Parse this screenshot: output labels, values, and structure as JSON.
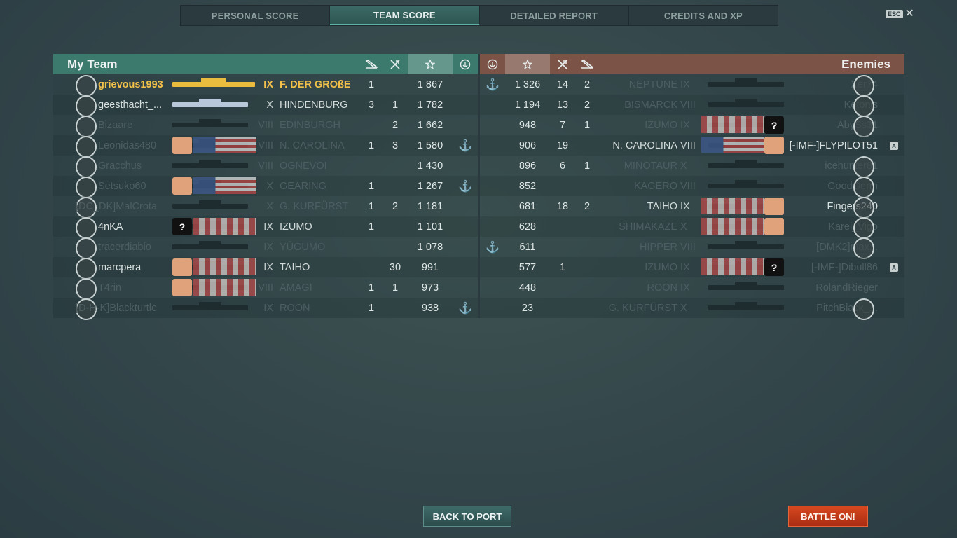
{
  "tabs": [
    {
      "label": "PERSONAL SCORE",
      "active": false
    },
    {
      "label": "TEAM SCORE",
      "active": true
    },
    {
      "label": "DETAILED REPORT",
      "active": false
    },
    {
      "label": "CREDITS AND XP",
      "active": false
    }
  ],
  "esc": {
    "key": "ESC",
    "icon": "close-icon"
  },
  "my_team": {
    "title": "My Team",
    "columns": [
      "torpedo-hits-icon",
      "planes-shot-icon",
      "score-star-icon",
      "capture-icon"
    ],
    "rows": [
      {
        "player": "grievous1993",
        "tier": "IX",
        "ship": "F. DER GROßE",
        "c1": "1",
        "c2": "",
        "score": "1 867",
        "anchor": false,
        "self": true,
        "dim": false
      },
      {
        "player": "geesthacht_...",
        "tier": "X",
        "ship": "HINDENBURG",
        "c1": "3",
        "c2": "1",
        "score": "1 782",
        "anchor": false,
        "self": false,
        "dim": false
      },
      {
        "player": "Bizaare",
        "tier": "VIII",
        "ship": "EDINBURGH",
        "c1": "",
        "c2": "2",
        "score": "1 662",
        "anchor": false,
        "self": false,
        "dim": true
      },
      {
        "player": "Leonidas480",
        "tier": "VIII",
        "ship": "N. CAROLINA",
        "c1": "1",
        "c2": "3",
        "score": "1 580",
        "anchor": true,
        "self": false,
        "dim": true
      },
      {
        "player": "Gracchus",
        "tier": "VIII",
        "ship": "OGNEVOI",
        "c1": "",
        "c2": "",
        "score": "1 430",
        "anchor": false,
        "self": false,
        "dim": true
      },
      {
        "player": "Setsuko60",
        "tier": "X",
        "ship": "GEARING",
        "c1": "1",
        "c2": "",
        "score": "1 267",
        "anchor": true,
        "self": false,
        "dim": true
      },
      {
        "player": "[DC_DK]MalCrota",
        "tier": "X",
        "ship": "G. KURFÜRST",
        "c1": "1",
        "c2": "2",
        "score": "1 181",
        "anchor": false,
        "self": false,
        "dim": true
      },
      {
        "player": "4nKA",
        "tier": "IX",
        "ship": "IZUMO",
        "c1": "1",
        "c2": "",
        "score": "1 101",
        "anchor": false,
        "self": false,
        "dim": false
      },
      {
        "player": "tracerdiablo",
        "tier": "IX",
        "ship": "YŪGUMO",
        "c1": "",
        "c2": "",
        "score": "1 078",
        "anchor": false,
        "self": false,
        "dim": true
      },
      {
        "player": "marcpera",
        "tier": "IX",
        "ship": "TAIHO",
        "c1": "",
        "c2": "30",
        "score": "991",
        "anchor": false,
        "self": false,
        "dim": false
      },
      {
        "player": "T4rin",
        "tier": "VIII",
        "ship": "AMAGI",
        "c1": "1",
        "c2": "1",
        "score": "973",
        "anchor": false,
        "self": false,
        "dim": true
      },
      {
        "player": "[D-H-K]Blackturtle",
        "tier": "IX",
        "ship": "ROON",
        "c1": "1",
        "c2": "",
        "score": "938",
        "anchor": true,
        "self": false,
        "dim": true
      }
    ]
  },
  "enemies": {
    "title": "Enemies",
    "columns": [
      "capture-icon",
      "score-star-icon",
      "planes-shot-icon",
      "torpedo-hits-icon"
    ],
    "rows": [
      {
        "player": "Xer74",
        "tier": "IX",
        "ship": "NEPTUNE",
        "c1": "14",
        "c2": "2",
        "score": "1 326",
        "anchor": true,
        "dim": true,
        "division": ""
      },
      {
        "player": "Ketonis",
        "tier": "VIII",
        "ship": "BISMARCK",
        "c1": "13",
        "c2": "2",
        "score": "1 194",
        "anchor": false,
        "dim": true,
        "division": ""
      },
      {
        "player": "AbySs31",
        "tier": "IX",
        "ship": "IZUMO",
        "c1": "7",
        "c2": "1",
        "score": "948",
        "anchor": false,
        "dim": true,
        "division": ""
      },
      {
        "player": "[-IMF-]FLYPILOT51",
        "tier": "VIII",
        "ship": "N. CAROLINA",
        "c1": "19",
        "c2": "",
        "score": "906",
        "anchor": false,
        "dim": false,
        "division": "A"
      },
      {
        "player": "icehunter81",
        "tier": "X",
        "ship": "MINOTAUR",
        "c1": "6",
        "c2": "1",
        "score": "896",
        "anchor": false,
        "dim": true,
        "division": ""
      },
      {
        "player": "GoodGerm",
        "tier": "VIII",
        "ship": "KAGERO",
        "c1": "",
        "c2": "",
        "score": "852",
        "anchor": false,
        "dim": true,
        "division": ""
      },
      {
        "player": "Fingers240",
        "tier": "IX",
        "ship": "TAIHO",
        "c1": "18",
        "c2": "2",
        "score": "681",
        "anchor": false,
        "dim": false,
        "division": ""
      },
      {
        "player": "Karel_Vigo",
        "tier": "X",
        "ship": "SHIMAKAZE",
        "c1": "",
        "c2": "",
        "score": "628",
        "anchor": false,
        "dim": true,
        "division": ""
      },
      {
        "player": "[DMK2]max...",
        "tier": "VIII",
        "ship": "HIPPER",
        "c1": "",
        "c2": "",
        "score": "611",
        "anchor": true,
        "dim": true,
        "division": ""
      },
      {
        "player": "[-IMF-]Dibull86",
        "tier": "IX",
        "ship": "IZUMO",
        "c1": "1",
        "c2": "",
        "score": "577",
        "anchor": false,
        "dim": true,
        "division": "A"
      },
      {
        "player": "RolandRieger",
        "tier": "IX",
        "ship": "ROON",
        "c1": "",
        "c2": "",
        "score": "448",
        "anchor": false,
        "dim": true,
        "division": ""
      },
      {
        "player": "PitchBlack_...",
        "tier": "X",
        "ship": "G. KURFÜRST",
        "c1": "",
        "c2": "",
        "score": "23",
        "anchor": false,
        "dim": true,
        "division": ""
      }
    ]
  },
  "anchor_glyph": "⚓",
  "buttons": {
    "back": "BACK TO PORT",
    "battle": "BATTLE ON!"
  }
}
